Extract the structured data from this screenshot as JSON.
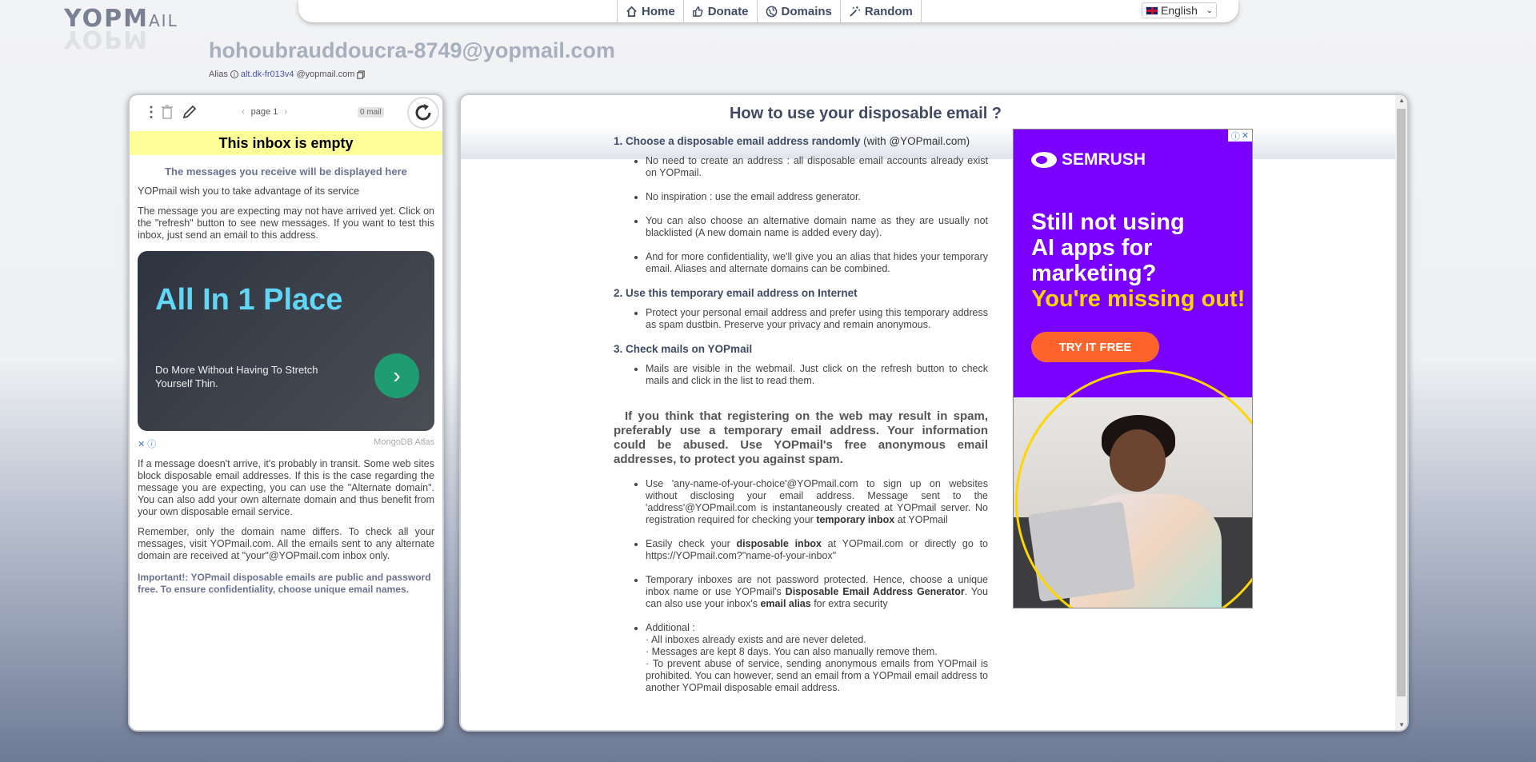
{
  "logo": {
    "text": "YOPMAIL",
    "main": "YOPM",
    "small": "AIL"
  },
  "nav": {
    "links": [
      {
        "label": "Home",
        "icon": "home-icon"
      },
      {
        "label": "Donate",
        "icon": "thumbs-up-icon"
      },
      {
        "label": "Domains",
        "icon": "globe-icon"
      },
      {
        "label": "Random",
        "icon": "magic-wand-icon"
      }
    ],
    "language": "English"
  },
  "header": {
    "email": "hohoubrauddoucra-8749@yopmail.com",
    "alias_label": "Alias",
    "alias_value": "alt.dk-fr013v4",
    "alias_domain": "@yopmail.com"
  },
  "inbox": {
    "page_label": "page 1",
    "mail_count": "0 mail",
    "empty_title": "This inbox is empty",
    "subtitle": "The messages you receive will be displayed here",
    "p1": "YOPmail wish you to take advantage of its service",
    "p2": "The message you are expecting may not have arrived yet. Click on the \"refresh\" button to see new messages. If you want to test this inbox, just send an email to this address.",
    "ad": {
      "title": "All In 1 Place",
      "text": "Do More Without Having To Stretch Yourself Thin.",
      "sponsor": "MongoDB Atlas"
    },
    "p3": "If a message doesn't arrive, it's probably in transit. Some web sites block disposable email addresses. If this is the case regarding the message you are expecting, you can use the \"Alternate domain\". You can also add your own alternate domain and thus benefit from your own disposable email service.",
    "p4": "Remember, only the domain name differs. To check all your messages, visit YOPmail.com. All the emails sent to any alternate domain are received at \"your\"@YOPmail.com inbox only.",
    "important": "Important!: YOPmail disposable emails are public and password free. To ensure confidentiality, choose unique email names."
  },
  "guide": {
    "title": "How to use your disposable email ?",
    "s1_title": "1. Choose a disposable email address randomly",
    "s1_suffix": "(with @YOPmail.com)",
    "s1_items": [
      "No need to create an address : all disposable email accounts already exist on YOPmail.",
      "No inspiration : use the email address generator.",
      "You can also choose an alternative domain name as they are usually not blacklisted (A new domain name is added every day).",
      "And for more confidentiality, we'll give you an alias that hides your temporary email. Aliases and alternate domains can be combined."
    ],
    "s2_title": "2. Use this temporary email address on Internet",
    "s2_items": [
      "Protect your personal email address and prefer using this temporary address as spam dustbin. Preserve your privacy and remain anonymous."
    ],
    "s3_title": "3. Check mails on YOPmail",
    "s3_items": [
      "Mails are visible in the webmail. Just click on the refresh button to check mails and click in the list to read them."
    ],
    "big_text": "If you think that registering on the web may result in spam, preferably use a temporary email address. Your information could be abused. Use YOPmail's free anonymous email addresses, to protect you against spam.",
    "b1_pre": "Use 'any-name-of-your-choice'@YOPmail.com to sign up on websites without disclosing your email address. Message sent to the 'address'@YOPmail.com is instantaneously created at YOPmail server. No registration required for checking your",
    "b1_bold": "temporary inbox",
    "b1_post": "at YOPmail",
    "b2_pre": "Easily check your",
    "b2_bold": "disposable inbox",
    "b2_post": "at YOPmail.com or directly go to https://YOPmail.com?\"name-of-your-inbox\"",
    "b3_pre": "Temporary inboxes are not password protected. Hence, choose a unique inbox name or use YOPmail's",
    "b3_bold": "Disposable Email Address Generator",
    "b3_mid": ". You can also use your inbox's",
    "b3_bold2": "email alias",
    "b3_post": "for extra security",
    "b4_title": "Additional :",
    "b4_lines": [
      "· All inboxes already exists and are never deleted.",
      "· Messages are kept 8 days. You can also manually remove them.",
      "· To prevent abuse of service, sending anonymous emails from YOPmail is prohibited. You can however, send an email from a YOPmail email address to another YOPmail disposable email address."
    ]
  },
  "semrush_ad": {
    "brand": "SEMRUSH",
    "line1": "Still not using",
    "line2": "AI apps for",
    "line3": "marketing?",
    "line4": "You're missing out!",
    "cta": "TRY IT FREE"
  }
}
